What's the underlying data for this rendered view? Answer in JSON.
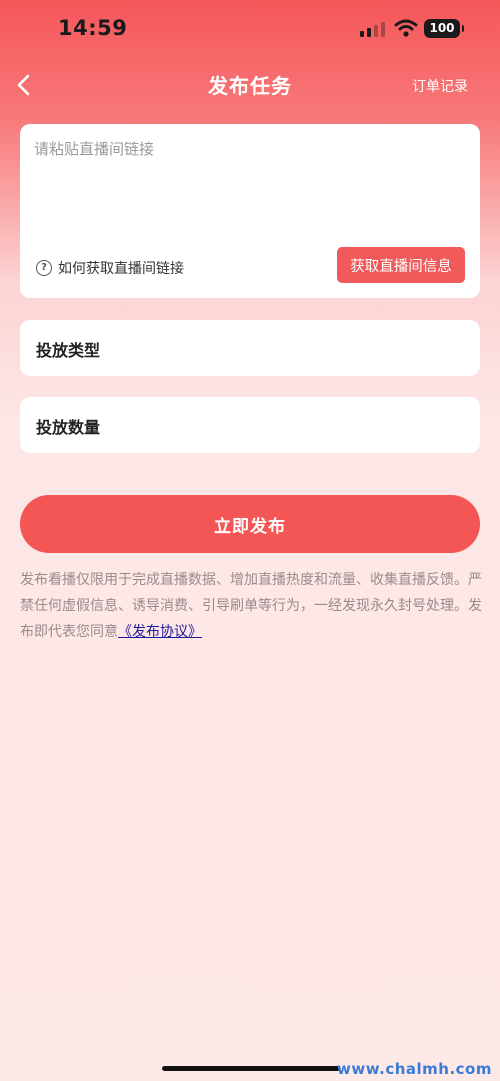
{
  "status_bar": {
    "time": "14:59",
    "battery": "100",
    "icons": [
      "signal-icon",
      "wifi-icon",
      "battery-icon"
    ]
  },
  "nav": {
    "back_icon": "chevron-left-icon",
    "title": "发布任务",
    "right_link": "订单记录"
  },
  "link_card": {
    "placeholder": "请粘贴直播间链接",
    "value": "",
    "help_icon": "question-circle-icon",
    "howto_text": "如何获取直播间链接",
    "fetch_button": "获取直播间信息"
  },
  "form": {
    "type_label": "投放类型",
    "quantity_label": "投放数量"
  },
  "publish_button": "立即发布",
  "notice": {
    "text": "发布看播仅限用于完成直播数据、增加直播热度和流量、收集直播反馈。严禁任何虚假信息、诱导消费、引导刷单等行为，一经发现永久封号处理。发布即代表您同意",
    "agreement_link": "《发布协议》"
  },
  "watermark": "www.chalmh.com",
  "colors": {
    "header_red": "#f5575a",
    "button_red": "#f45656",
    "page_background": "#fee9e9",
    "link_blue": "#1a1a9a"
  }
}
